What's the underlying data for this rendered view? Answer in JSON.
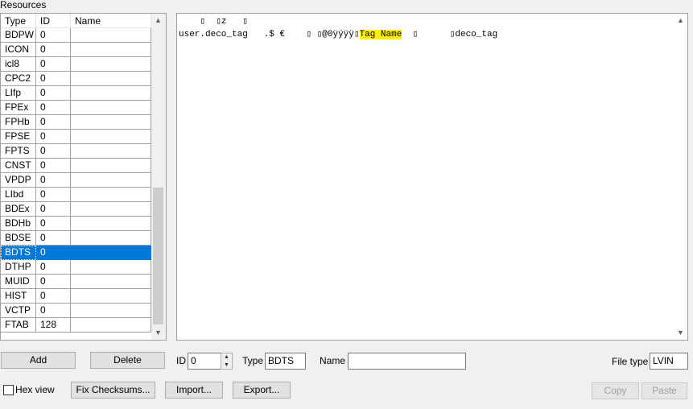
{
  "resources_label": "Resources",
  "table": {
    "columns": [
      "Type",
      "ID",
      "Name"
    ],
    "rows": [
      {
        "type": "BDPW",
        "id": "0",
        "name": ""
      },
      {
        "type": "ICON",
        "id": "0",
        "name": ""
      },
      {
        "type": "icl8",
        "id": "0",
        "name": ""
      },
      {
        "type": "CPC2",
        "id": "0",
        "name": ""
      },
      {
        "type": "LIfp",
        "id": "0",
        "name": ""
      },
      {
        "type": "FPEx",
        "id": "0",
        "name": ""
      },
      {
        "type": "FPHb",
        "id": "0",
        "name": ""
      },
      {
        "type": "FPSE",
        "id": "0",
        "name": ""
      },
      {
        "type": "FPTS",
        "id": "0",
        "name": ""
      },
      {
        "type": "CNST",
        "id": "0",
        "name": ""
      },
      {
        "type": "VPDP",
        "id": "0",
        "name": ""
      },
      {
        "type": "LIbd",
        "id": "0",
        "name": ""
      },
      {
        "type": "BDEx",
        "id": "0",
        "name": ""
      },
      {
        "type": "BDHb",
        "id": "0",
        "name": ""
      },
      {
        "type": "BDSE",
        "id": "0",
        "name": ""
      },
      {
        "type": "BDTS",
        "id": "0",
        "name": "",
        "selected": true
      },
      {
        "type": "DTHP",
        "id": "0",
        "name": ""
      },
      {
        "type": "MUID",
        "id": "0",
        "name": ""
      },
      {
        "type": "HIST",
        "id": "0",
        "name": ""
      },
      {
        "type": "VCTP",
        "id": "0",
        "name": ""
      },
      {
        "type": "FTAB",
        "id": "128",
        "name": ""
      }
    ]
  },
  "content": {
    "line1": "    ▯  ▯z   ▯",
    "line2_pre": "user.deco_tag   .$ €    ▯ ▯@0ÿÿÿÿ▯",
    "line2_highlight": "Tag Name",
    "line2_post": "  ▯      ▯deco_tag"
  },
  "controls": {
    "add_label": "Add",
    "delete_label": "Delete",
    "id_label": "ID",
    "id_value": "0",
    "type_label": "Type",
    "type_value": "BDTS",
    "name_label": "Name",
    "name_value": "",
    "file_type_label": "File type",
    "file_type_value": "LVIN",
    "hex_view_label": "Hex view",
    "fix_checksums_label": "Fix Checksums...",
    "import_label": "Import...",
    "export_label": "Export...",
    "copy_label": "Copy",
    "paste_label": "Paste"
  },
  "colors": {
    "selection": "#0078d7",
    "highlight": "#ffee00"
  }
}
